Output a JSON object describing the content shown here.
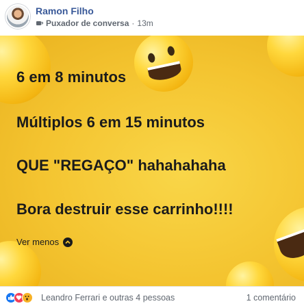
{
  "post": {
    "author": "Ramon Filho",
    "group": "Puxador de conversa",
    "time": "13m",
    "separator": "·"
  },
  "content": {
    "lines": [
      "6 em 8 minutos",
      "Múltiplos 6 em 15 minutos",
      "QUE \"REGAÇO\" hahahahaha",
      "Bora destruir esse carrinho!!!!"
    ],
    "see_less": "Ver menos",
    "background_color": "#f4c430"
  },
  "footer": {
    "reactions": [
      "like-icon",
      "love-icon",
      "wow-icon"
    ],
    "reactors": "Leandro Ferrari e outras 4 pessoas",
    "comments": "1 comentário"
  },
  "colors": {
    "author_link": "#385898",
    "meta_text": "#606770",
    "like": "#1877f2",
    "love": "#f33e58",
    "wow": "#f7b125"
  }
}
